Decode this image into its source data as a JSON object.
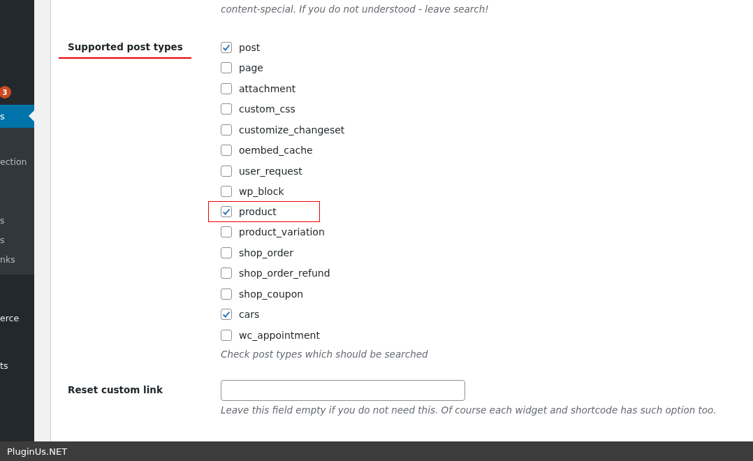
{
  "sidebar": {
    "badge": "3",
    "active_item": {
      "label": "s",
      "selected": true
    },
    "submenu": [
      "ection",
      "s",
      "s",
      "nks"
    ],
    "items": [
      "erce",
      "ts"
    ]
  },
  "intro_note": "content-special. If you do not understood - leave search!",
  "post_types": {
    "label": "Supported post types",
    "underlined": true,
    "options": [
      {
        "label": "post",
        "checked": true,
        "highlighted": false
      },
      {
        "label": "page",
        "checked": false,
        "highlighted": false
      },
      {
        "label": "attachment",
        "checked": false,
        "highlighted": false
      },
      {
        "label": "custom_css",
        "checked": false,
        "highlighted": false
      },
      {
        "label": "customize_changeset",
        "checked": false,
        "highlighted": false
      },
      {
        "label": "oembed_cache",
        "checked": false,
        "highlighted": false
      },
      {
        "label": "user_request",
        "checked": false,
        "highlighted": false
      },
      {
        "label": "wp_block",
        "checked": false,
        "highlighted": false
      },
      {
        "label": "product",
        "checked": true,
        "highlighted": true
      },
      {
        "label": "product_variation",
        "checked": false,
        "highlighted": false
      },
      {
        "label": "shop_order",
        "checked": false,
        "highlighted": false
      },
      {
        "label": "shop_order_refund",
        "checked": false,
        "highlighted": false
      },
      {
        "label": "shop_coupon",
        "checked": false,
        "highlighted": false
      },
      {
        "label": "cars",
        "checked": true,
        "highlighted": false
      },
      {
        "label": "wc_appointment",
        "checked": false,
        "highlighted": false
      }
    ],
    "description": "Check post types which should be searched"
  },
  "reset_link": {
    "label": "Reset custom link",
    "description": "Leave this field empty if you do not need this. Of course each widget and shortcode has such option too."
  },
  "footer": "PluginUs.NET"
}
